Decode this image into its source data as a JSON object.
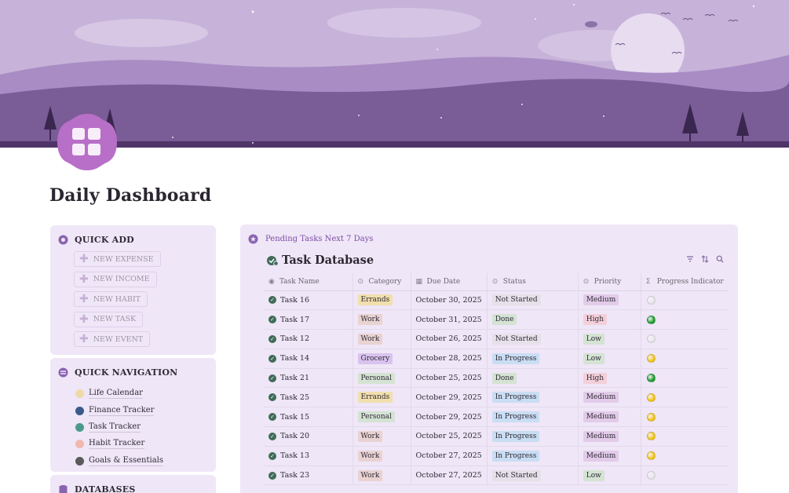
{
  "page": {
    "title": "Daily Dashboard"
  },
  "colors": {
    "accent": "#7c4ea6",
    "card_bg": "#efe6f7",
    "banner_sky": "#c7b3d9",
    "banner_hills": "#7a5c96"
  },
  "quick_add": {
    "title": "QUICK ADD",
    "icon": "circle-dot-icon",
    "buttons": [
      {
        "label": "NEW EXPENSE",
        "icon": "plus-icon"
      },
      {
        "label": "NEW INCOME",
        "icon": "plus-icon"
      },
      {
        "label": "NEW HABIT",
        "icon": "plus-icon"
      },
      {
        "label": "NEW TASK",
        "icon": "plus-icon"
      },
      {
        "label": "NEW EVENT",
        "icon": "plus-icon"
      }
    ]
  },
  "quick_nav": {
    "title": "QUICK NAVIGATION",
    "icon": "navigation-icon",
    "items": [
      {
        "label": "Life Calendar",
        "icon": "calendar-icon",
        "color": "#efd9a8"
      },
      {
        "label": "Finance Tracker",
        "icon": "chart-icon",
        "color": "#3a5a8c"
      },
      {
        "label": "Task Tracker",
        "icon": "task-icon",
        "color": "#4a9a8a"
      },
      {
        "label": "Habit Tracker",
        "icon": "habit-icon",
        "color": "#f2b8b0"
      },
      {
        "label": "Goals & Essentials",
        "icon": "goals-icon",
        "color": "#5a5a5a"
      }
    ]
  },
  "databases": {
    "title": "DATABASES",
    "icon": "database-icon"
  },
  "tasks_panel": {
    "heading": "Pending Tasks Next 7 Days",
    "heading_icon": "star-icon",
    "db_title": "Task Database",
    "db_icon": "task-check-icon",
    "tools": [
      "filter-icon",
      "sort-icon",
      "search-icon"
    ],
    "columns": [
      "Task Name",
      "Category",
      "Due Date",
      "Status",
      "Priority",
      "Progress Indicator"
    ],
    "rows": [
      {
        "name": "Task 16",
        "category": "Errands",
        "due": "October 30, 2025",
        "status": "Not Started",
        "priority": "Medium",
        "progress": "not-started"
      },
      {
        "name": "Task 17",
        "category": "Work",
        "due": "October 31, 2025",
        "status": "Done",
        "priority": "High",
        "progress": "done"
      },
      {
        "name": "Task 12",
        "category": "Work",
        "due": "October 26, 2025",
        "status": "Not Started",
        "priority": "Low",
        "progress": "not-started"
      },
      {
        "name": "Task 14",
        "category": "Grocery",
        "due": "October 28, 2025",
        "status": "In Progress",
        "priority": "Low",
        "progress": "in-progress"
      },
      {
        "name": "Task 21",
        "category": "Personal",
        "due": "October 25, 2025",
        "status": "Done",
        "priority": "High",
        "progress": "done"
      },
      {
        "name": "Task 25",
        "category": "Errands",
        "due": "October 29, 2025",
        "status": "In Progress",
        "priority": "Medium",
        "progress": "in-progress"
      },
      {
        "name": "Task 15",
        "category": "Personal",
        "due": "October 29, 2025",
        "status": "In Progress",
        "priority": "Medium",
        "progress": "in-progress"
      },
      {
        "name": "Task 20",
        "category": "Work",
        "due": "October 25, 2025",
        "status": "In Progress",
        "priority": "Medium",
        "progress": "in-progress"
      },
      {
        "name": "Task 13",
        "category": "Work",
        "due": "October 27, 2025",
        "status": "In Progress",
        "priority": "Medium",
        "progress": "in-progress"
      },
      {
        "name": "Task 23",
        "category": "Work",
        "due": "October 27, 2025",
        "status": "Not Started",
        "priority": "Low",
        "progress": "not-started"
      }
    ],
    "tag_colors": {
      "category": {
        "Errands": "#f1dfad",
        "Work": "#e9d2d2",
        "Grocery": "#d9c3ee",
        "Personal": "#d4e3d3"
      },
      "status": {
        "Not Started": "#e6e0e8",
        "Done": "#d4e3d3",
        "In Progress": "#c9ddf3"
      },
      "priority": {
        "Medium": "#e2cbe9",
        "High": "#f3cfd9",
        "Low": "#d4e3d3"
      },
      "progress": {
        "not-started": "#e8e4ea",
        "done": "#1f9b2e",
        "in-progress": "#f0c419"
      }
    }
  }
}
